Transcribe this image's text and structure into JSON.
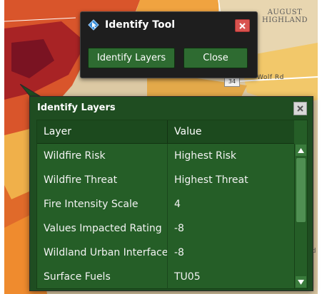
{
  "map": {
    "place_line1": "AUGUST",
    "place_line2": "HIGHLAND",
    "road_badge": "34",
    "road_name": "Wolf Rd",
    "edge_label": "Rd"
  },
  "identify_tool": {
    "title": "Identify Tool",
    "icon": "identify-pointer-icon",
    "identify_button": "Identify Layers",
    "close_button": "Close"
  },
  "identify_layers": {
    "title": "Identify Layers",
    "columns": [
      "Layer",
      "Value"
    ],
    "rows": [
      {
        "layer": "Wildfire Risk",
        "value": "Highest Risk"
      },
      {
        "layer": "Wildfire Threat",
        "value": "Highest Threat"
      },
      {
        "layer": "Fire Intensity Scale",
        "value": "4"
      },
      {
        "layer": "Values Impacted Rating",
        "value": "-8"
      },
      {
        "layer": "Wildland Urban Interface",
        "value": "-8"
      },
      {
        "layer": "Surface Fuels",
        "value": "TU05"
      }
    ]
  },
  "colors": {
    "panel_green": "#1f4d21",
    "grid_green": "#255e27",
    "button_green": "#2e6b31",
    "tool_bg": "#1e1e1e",
    "close_red": "#d9534f"
  }
}
